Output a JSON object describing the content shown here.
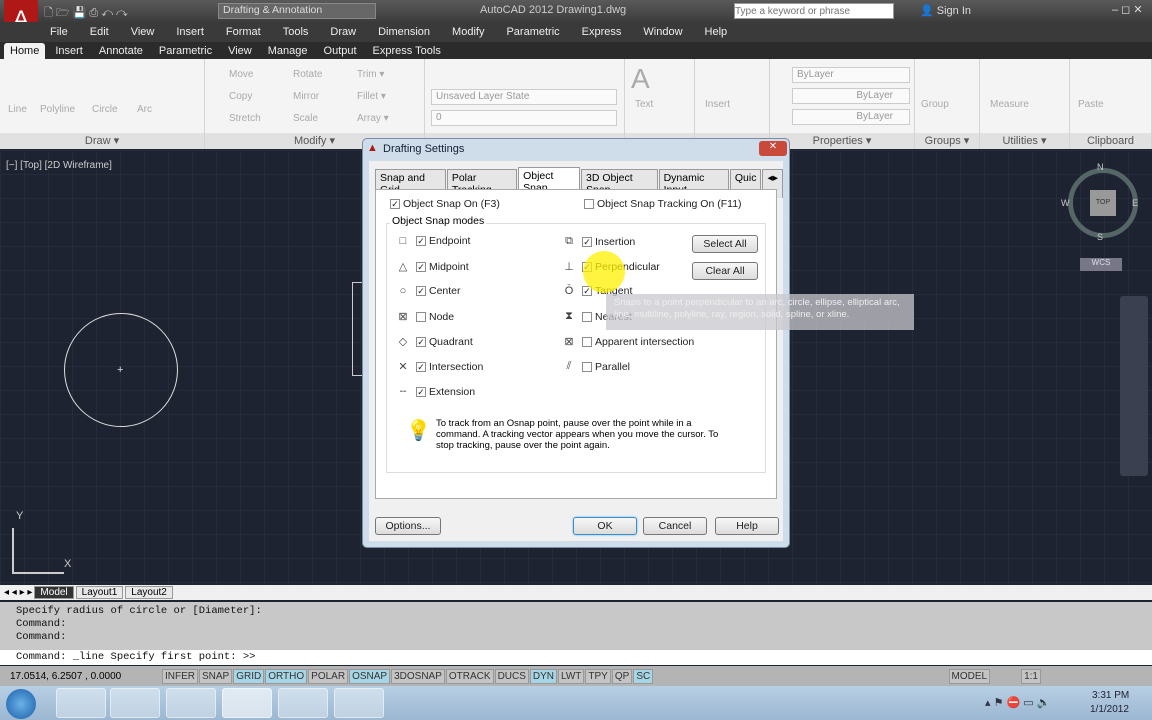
{
  "titlebar": {
    "workspace": "Drafting & Annotation",
    "title": "AutoCAD 2012   Drawing1.dwg",
    "search_placeholder": "Type a keyword or phrase",
    "sign_in": "Sign In"
  },
  "menu": [
    "File",
    "Edit",
    "View",
    "Insert",
    "Format",
    "Tools",
    "Draw",
    "Dimension",
    "Modify",
    "Parametric",
    "Express",
    "Window",
    "Help"
  ],
  "ribbon_tabs": [
    "Home",
    "Insert",
    "Annotate",
    "Parametric",
    "View",
    "Manage",
    "Output",
    "Express Tools"
  ],
  "ribbon": {
    "draw": {
      "label": "Draw ▾",
      "tools": [
        "Line",
        "Polyline",
        "Circle",
        "Arc"
      ]
    },
    "modify": {
      "label": "Modify ▾",
      "tools": [
        "Move",
        "Rotate",
        "Trim ▾",
        "Copy",
        "Mirror",
        "Fillet ▾",
        "Stretch",
        "Scale",
        "Array ▾"
      ]
    },
    "layers": {
      "layer_state": "Unsaved Layer State",
      "current_layer": "0"
    },
    "annotation": {
      "text": "Text"
    },
    "block": {
      "insert": "Insert"
    },
    "properties": {
      "label": "Properties ▾",
      "color": "ByLayer",
      "linetype": "ByLayer",
      "lineweight": "ByLayer"
    },
    "groups": {
      "label": "Groups ▾",
      "group": "Group"
    },
    "utilities": {
      "label": "Utilities ▾",
      "measure": "Measure"
    },
    "clipboard": {
      "label": "Clipboard",
      "paste": "Paste"
    }
  },
  "viewport": {
    "label": "[−] [Top] [2D Wireframe]",
    "compass": {
      "n": "N",
      "s": "S",
      "e": "E",
      "w": "W",
      "top": "TOP"
    },
    "wcs": "WCS",
    "ucs_x": "X",
    "ucs_y": "Y"
  },
  "layout_tabs": [
    "Model",
    "Layout1",
    "Layout2"
  ],
  "command": {
    "history": [
      "Specify radius of circle or [Diameter]:",
      "Command:",
      "Command:"
    ],
    "current": "Command:  _line Specify first point:  >>"
  },
  "status": {
    "coords": "17.0514, 6.2507 , 0.0000",
    "toggles": [
      {
        "label": "INFER",
        "on": false
      },
      {
        "label": "SNAP",
        "on": false
      },
      {
        "label": "GRID",
        "on": true
      },
      {
        "label": "ORTHO",
        "on": true
      },
      {
        "label": "POLAR",
        "on": false
      },
      {
        "label": "OSNAP",
        "on": true
      },
      {
        "label": "3DOSNAP",
        "on": false
      },
      {
        "label": "OTRACK",
        "on": false
      },
      {
        "label": "DUCS",
        "on": false
      },
      {
        "label": "DYN",
        "on": true
      },
      {
        "label": "LWT",
        "on": false
      },
      {
        "label": "TPY",
        "on": false
      },
      {
        "label": "QP",
        "on": false
      },
      {
        "label": "SC",
        "on": true
      }
    ],
    "model": "MODEL",
    "scale": "1:1"
  },
  "taskbar": {
    "time": "3:31 PM",
    "date": "1/1/2012"
  },
  "dialog": {
    "title": "Drafting Settings",
    "tabs": [
      "Snap and Grid",
      "Polar Tracking",
      "Object Snap",
      "3D Object Snap",
      "Dynamic Input",
      "Quic"
    ],
    "active_tab": "Object Snap",
    "osnap_on": {
      "label": "Object Snap On (F3)",
      "checked": true
    },
    "otrack_on": {
      "label": "Object Snap Tracking On (F11)",
      "checked": false
    },
    "group_label": "Object Snap modes",
    "modes_left": [
      {
        "label": "Endpoint",
        "checked": true,
        "icon": "□"
      },
      {
        "label": "Midpoint",
        "checked": true,
        "icon": "△"
      },
      {
        "label": "Center",
        "checked": true,
        "icon": "○"
      },
      {
        "label": "Node",
        "checked": false,
        "icon": "⊠"
      },
      {
        "label": "Quadrant",
        "checked": true,
        "icon": "◇"
      },
      {
        "label": "Intersection",
        "checked": true,
        "icon": "✕"
      },
      {
        "label": "Extension",
        "checked": true,
        "icon": "╌"
      }
    ],
    "modes_right": [
      {
        "label": "Insertion",
        "checked": true,
        "icon": "⧉"
      },
      {
        "label": "Perpendicular",
        "checked": true,
        "icon": "⊥"
      },
      {
        "label": "Tangent",
        "checked": true,
        "icon": "Ō"
      },
      {
        "label": "Nearest",
        "checked": false,
        "icon": "⧗"
      },
      {
        "label": "Apparent intersection",
        "checked": false,
        "icon": "⊠"
      },
      {
        "label": "Parallel",
        "checked": false,
        "icon": "⫽"
      }
    ],
    "select_all": "Select All",
    "clear_all": "Clear All",
    "tip": "To track from an Osnap point, pause over the point while in a command.  A tracking vector appears when you move the cursor. To stop tracking, pause over the point again.",
    "tooltip": "Snaps to a point perpendicular to an arc, circle, ellipse, elliptical arc, line, multiline, polyline, ray, region, solid, spline, or xline.",
    "options": "Options...",
    "ok": "OK",
    "cancel": "Cancel",
    "help": "Help"
  }
}
